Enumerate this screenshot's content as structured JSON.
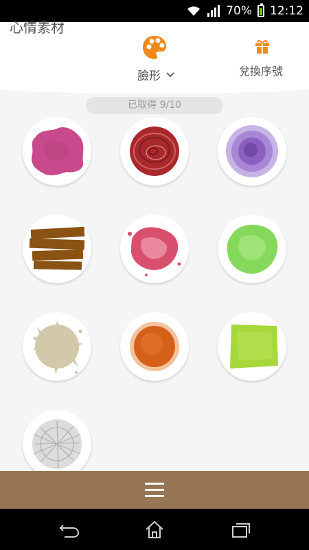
{
  "status_bar": {
    "battery": "70%",
    "time": "12:12"
  },
  "header": {
    "title": "心情素材",
    "category": "臉形",
    "redeem": "兌換序號"
  },
  "progress": {
    "label": "已取得 9/10",
    "collected": 9,
    "total": 10
  },
  "swatches": [
    {
      "name": "pink-blob",
      "color": "#c94a8c"
    },
    {
      "name": "red-scribble-circle",
      "color": "#a8282c"
    },
    {
      "name": "purple-crayon-circle",
      "color": "#8a5fc0"
    },
    {
      "name": "brown-brush-strokes",
      "color": "#8a5213"
    },
    {
      "name": "pink-watercolor-splash",
      "color": "#d9506e"
    },
    {
      "name": "green-watercolor",
      "color": "#86d85c"
    },
    {
      "name": "beige-splatter",
      "color": "#d2c8aa"
    },
    {
      "name": "orange-dust",
      "color": "#d4601a"
    },
    {
      "name": "lime-brush",
      "color": "#a6d83a"
    },
    {
      "name": "gray-sketch",
      "color": "#c8c8c8"
    }
  ],
  "colors": {
    "accent": "#f08a1c",
    "menu_bar": "#967654"
  }
}
